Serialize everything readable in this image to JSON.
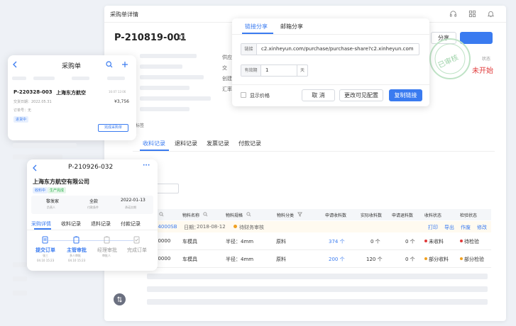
{
  "window": {
    "title": "采购单详情",
    "order_no": "P-210819-001",
    "share_button": "分享",
    "stamp_text": "已审核",
    "status_label": "状态",
    "status_value": "未开始",
    "field_labels": [
      "供应",
      "交",
      "创建",
      "汇率"
    ],
    "tag_label": "标签",
    "tabs": [
      "收料记录",
      "退料记录",
      "发票记录",
      "付款记录"
    ],
    "table": {
      "headers": [
        "物料名称",
        "物料规格",
        "物料分类",
        "申请收料数",
        "实际收料数",
        "申请退料数",
        "收料状态",
        "检验状态"
      ],
      "group_row": {
        "code": "04000SB",
        "date_label": "日期：",
        "date": "2018-08-12",
        "status": "待财务审核",
        "actions": [
          "打印",
          "导出",
          "作废",
          "修改"
        ]
      },
      "rows": [
        {
          "num": "00000",
          "name": "车模具",
          "spec": "半径：4mm",
          "category": "原料",
          "apply": "374 个",
          "actual": "0 个",
          "return": "0 个",
          "recv_status": "未收料",
          "insp_status": "待检验"
        },
        {
          "num": "00000",
          "name": "车模具",
          "spec": "半径：4mm",
          "category": "原料",
          "apply": "200 个",
          "actual": "120 个",
          "return": "0 个",
          "recv_status": "部分收料",
          "insp_status": "部分检验"
        }
      ]
    }
  },
  "share": {
    "tabs": [
      "链接分享",
      "邮箱分享"
    ],
    "link_label": "链接",
    "link_value": "c2.xinheyun.com/purchase/purchase-share?c2.xinheyun.com",
    "validity_label": "有效期",
    "validity_value": "1",
    "validity_unit": "天",
    "show_price": "显示价格",
    "cancel": "取 消",
    "change_visible": "更改可见配置",
    "copy_link": "复制链接"
  },
  "mobile_list": {
    "title": "采购单",
    "order_no": "P-220328-003",
    "supplier": "上海东方航空",
    "time": "16:07 12:06",
    "date_label": "交货日期：2022.05.31",
    "amount": "¥3,756",
    "order_label": "订单号：无",
    "badge": "进货中",
    "complete_button": "完成采购单"
  },
  "mobile_detail": {
    "order_no": "P-210926-032",
    "more": "···",
    "company": "上海东方航空有限公司",
    "tags": [
      "收料中",
      "生产完成"
    ],
    "stats": [
      {
        "value": "黎发家",
        "label": "负责人"
      },
      {
        "value": "全款",
        "label": "付款条件"
      },
      {
        "value": "2022-01-13",
        "label": "承诺交期"
      }
    ],
    "tabs": [
      "采购详情",
      "收料记录",
      "退料记录",
      "付款记录"
    ],
    "steps": [
      {
        "label": "提交订单",
        "who": "张三",
        "time": "04.10 15:23"
      },
      {
        "label": "主管审批",
        "who": "多人审批",
        "time": "04.10 15:23"
      },
      {
        "label": "经理审批",
        "who": "审批人",
        "time": ""
      },
      {
        "label": "完成订单",
        "who": "",
        "time": ""
      }
    ]
  },
  "colors": {
    "accent": "#3a7bf0",
    "danger": "#e03a3a",
    "success": "#2bb24c",
    "warning": "#f0a020"
  }
}
